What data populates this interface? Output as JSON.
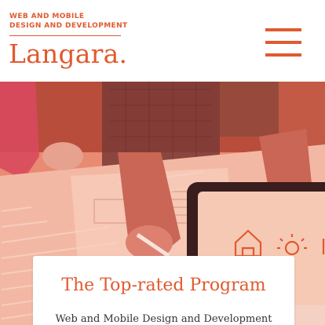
{
  "header": {
    "kicker_line1": "WEB AND MOBILE",
    "kicker_line2": "DESIGN AND DEVELOPMENT",
    "logo": "Langara."
  },
  "menu": {
    "icon": "hamburger-menu-icon"
  },
  "hero": {
    "title": "The Top-rated Program",
    "subtitle": "Web and Mobile Design and Development"
  },
  "colors": {
    "brand_orange": "#e05a2f",
    "hero_overlay": "#e6826b"
  }
}
